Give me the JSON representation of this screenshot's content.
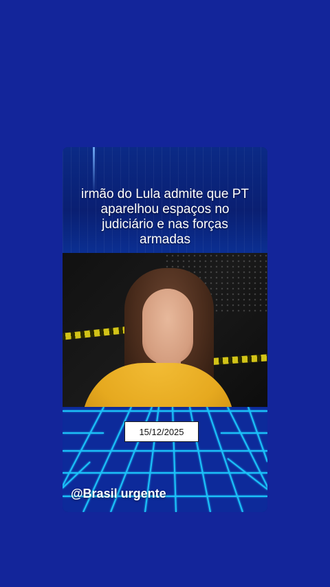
{
  "post": {
    "headline": "irmão do Lula admite que PT aparelhou espaços no judiciário e nas forças armadas",
    "date": "15/12/2025",
    "handle": "@Brasil urgente"
  },
  "colors": {
    "background": "#13259a",
    "grid_line": "#1ecbff",
    "jacket": "#f2bc35"
  }
}
